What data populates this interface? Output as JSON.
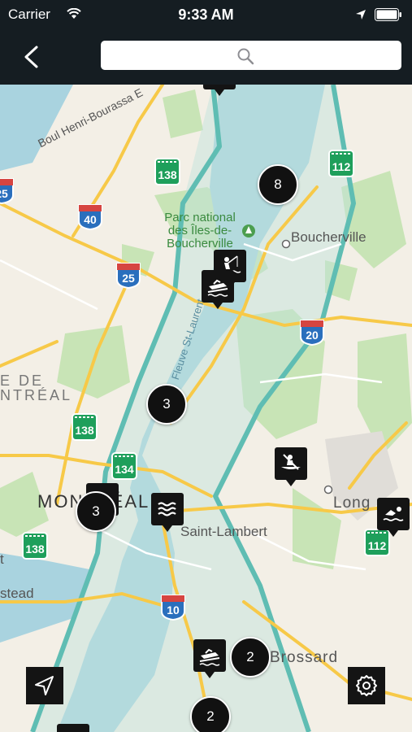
{
  "status_bar": {
    "carrier": "Carrier",
    "time": "9:33 AM"
  },
  "nav": {
    "search_placeholder": ""
  },
  "map_labels": {
    "boul": "Boul Henri-Bourassa E",
    "park_line1": "Parc national",
    "park_line2": "des Îles-de-",
    "park_line3": "Boucherville",
    "boucherville": "Boucherville",
    "fleuve": "Fleuve St-Laurent",
    "montreal_city": "MONTRÉAL",
    "montreal_region_1": "E DE",
    "montreal_region_2": "NTRÉAL",
    "saint_lambert": "Saint-Lambert",
    "longueuil": "Long",
    "brossard": "Brossard",
    "outremont_t": "t",
    "stead": "stead"
  },
  "clusters": [
    {
      "id": "cluster-8",
      "count": "8"
    },
    {
      "id": "cluster-3-river",
      "count": "3"
    },
    {
      "id": "cluster-3-montreal",
      "count": "3"
    },
    {
      "id": "cluster-2-brossard",
      "count": "2"
    },
    {
      "id": "cluster-2-bottom",
      "count": "2"
    }
  ],
  "pins": [
    {
      "id": "fishing",
      "icon": "fishing-icon"
    },
    {
      "id": "boat-launch-1",
      "icon": "boat-launch-icon"
    },
    {
      "id": "kayak",
      "icon": "kayak-icon"
    },
    {
      "id": "waves",
      "icon": "waves-icon"
    },
    {
      "id": "swimming",
      "icon": "swimming-icon"
    },
    {
      "id": "boat-launch-2",
      "icon": "boat-launch-icon"
    }
  ],
  "routes": {
    "r138_a": "138",
    "r112_a": "112",
    "a25_a": "25",
    "a40": "40",
    "a25_b": "25",
    "a20": "20",
    "r138_b": "138",
    "r134": "134",
    "r138_c": "138",
    "r112_b": "112",
    "a10": "10"
  },
  "colors": {
    "bar": "#151d22",
    "water": "#a9d3df",
    "zone_border": "#5fbdb3",
    "zone_fill": "#bfe3dc",
    "highway": "#f7c948",
    "green": "#bfe0b0"
  }
}
